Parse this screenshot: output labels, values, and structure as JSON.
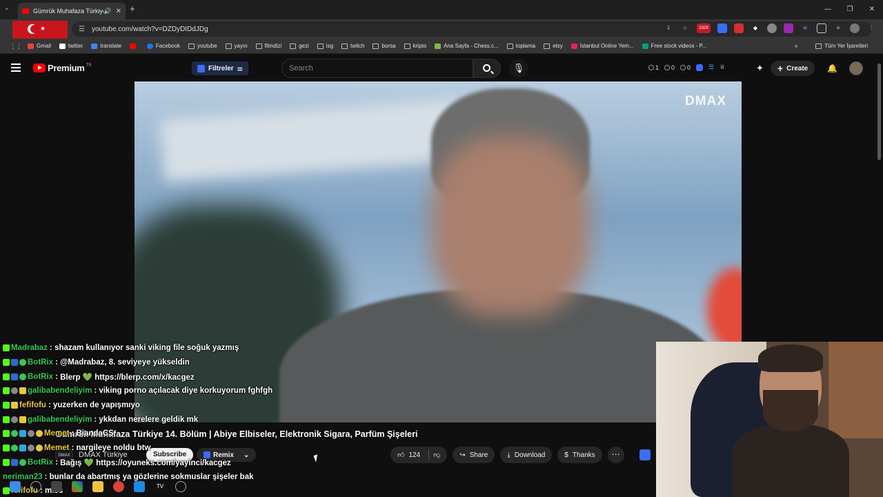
{
  "browser": {
    "tab_title": "Gümrük Muhafaza Türkiye",
    "url": "youtube.com/watch?v=DZDyDIDdJDg",
    "extension_count": "2329",
    "bookmarks": [
      "Gmail",
      "twitter",
      "translate",
      "Facebook",
      "youtube",
      "yayın",
      "filmdizi",
      "gezi",
      "isg",
      "twitch",
      "borsa",
      "kripto",
      "Ana Sayfa - Chess.c...",
      "toplama",
      "etsy",
      "İstanbul Online Yem...",
      "Free stock videos - P..."
    ],
    "bookmarks_overflow": "»",
    "all_bookmarks": "Tüm Yer İşaretleri"
  },
  "youtube": {
    "logo_text": "Premium",
    "logo_region": "TR",
    "filter_label": "Filtreler",
    "search_placeholder": "Search",
    "stats": {
      "a": "1",
      "b": "0",
      "c": "0"
    },
    "create_label": "Create"
  },
  "video": {
    "watermark": "DMAX",
    "title": "Gümrük Muhafaza Türkiye 14. Bölüm | Abiye Elbiseler, Elektronik Sigara, Parfüm Şişeleri",
    "channel": "DMAX Türkiye",
    "channel_logo": "DMAX",
    "subscribe": "Subscribe",
    "remix": "Remix",
    "likes": "124",
    "share": "Share",
    "download": "Download",
    "thanks": "Thanks"
  },
  "chat": [
    {
      "user": "Madrabaz",
      "color": "#36c75b",
      "text": "shazam kullanıyor sanki viking file soğuk yazmış"
    },
    {
      "user": "BotRix",
      "color": "#36c75b",
      "text": "@Madrabaz, 8. seviyeye yükseldin"
    },
    {
      "user": "BotRix",
      "color": "#36c75b",
      "text": "Blerp 💚 https://blerp.com/x/kacgez"
    },
    {
      "user": "galibabendeliyim",
      "color": "#36c75b",
      "text": "viking porno açılacak diye korkuyorum fghfgh"
    },
    {
      "user": "fefifofu",
      "color": "#e8c83a",
      "text": "yuzerken de yapışmıyo"
    },
    {
      "user": "galibabendeliyim",
      "color": "#36c75b",
      "text": "ykkdan nerelere geldik mk"
    },
    {
      "user": "Memet",
      "color": "#e8c83a",
      "text": "BiandaCS"
    },
    {
      "user": "Memet",
      "color": "#e8c83a",
      "text": "nargileye noldu btw"
    },
    {
      "user": "BotRix",
      "color": "#36c75b",
      "text": "Bağış 💚 https://oyuneks.com/yayinci/kacgez"
    },
    {
      "user": "neriman23",
      "color": "#36c75b",
      "text": "bunlar da abartmış ya gözlerine sokmuslar şişeler bak"
    },
    {
      "user": "fefifofu",
      "color": "#e8c83a",
      "text": "miss"
    }
  ]
}
